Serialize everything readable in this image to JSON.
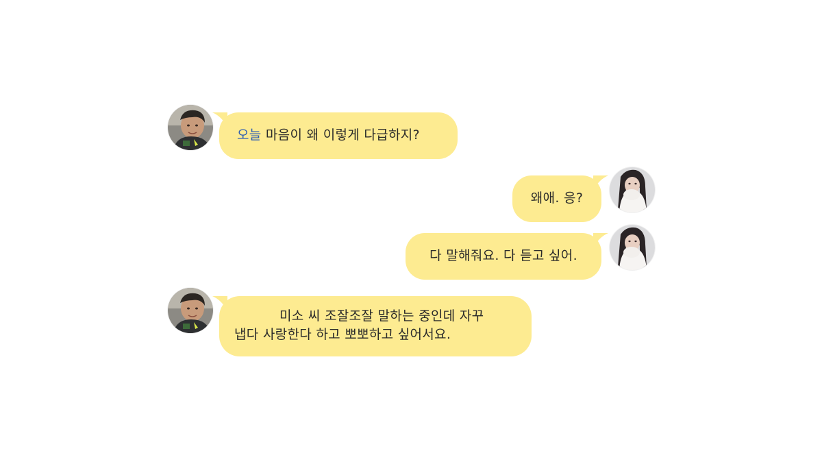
{
  "colors": {
    "bubble": "#fdeb91",
    "text": "#2a2a2a",
    "highlight": "#2f5fb3",
    "background": "#ffffff"
  },
  "messages": [
    {
      "sender": "left",
      "avatar_icon": "male-profile-photo",
      "highlight": "오늘",
      "text": " 마음이 왜 이렇게 다급하지?"
    },
    {
      "sender": "right",
      "avatar_icon": "female-profile-photo",
      "text": "왜애. 응?"
    },
    {
      "sender": "right",
      "avatar_icon": "female-profile-photo",
      "text": "다 말해줘요. 다 듣고 싶어."
    },
    {
      "sender": "left",
      "avatar_icon": "male-profile-photo",
      "line1": "미소 씨 조잘조잘 말하는 중인데 자꾸",
      "line2": "냅다 사랑한다 하고 뽀뽀하고 싶어서요."
    }
  ]
}
